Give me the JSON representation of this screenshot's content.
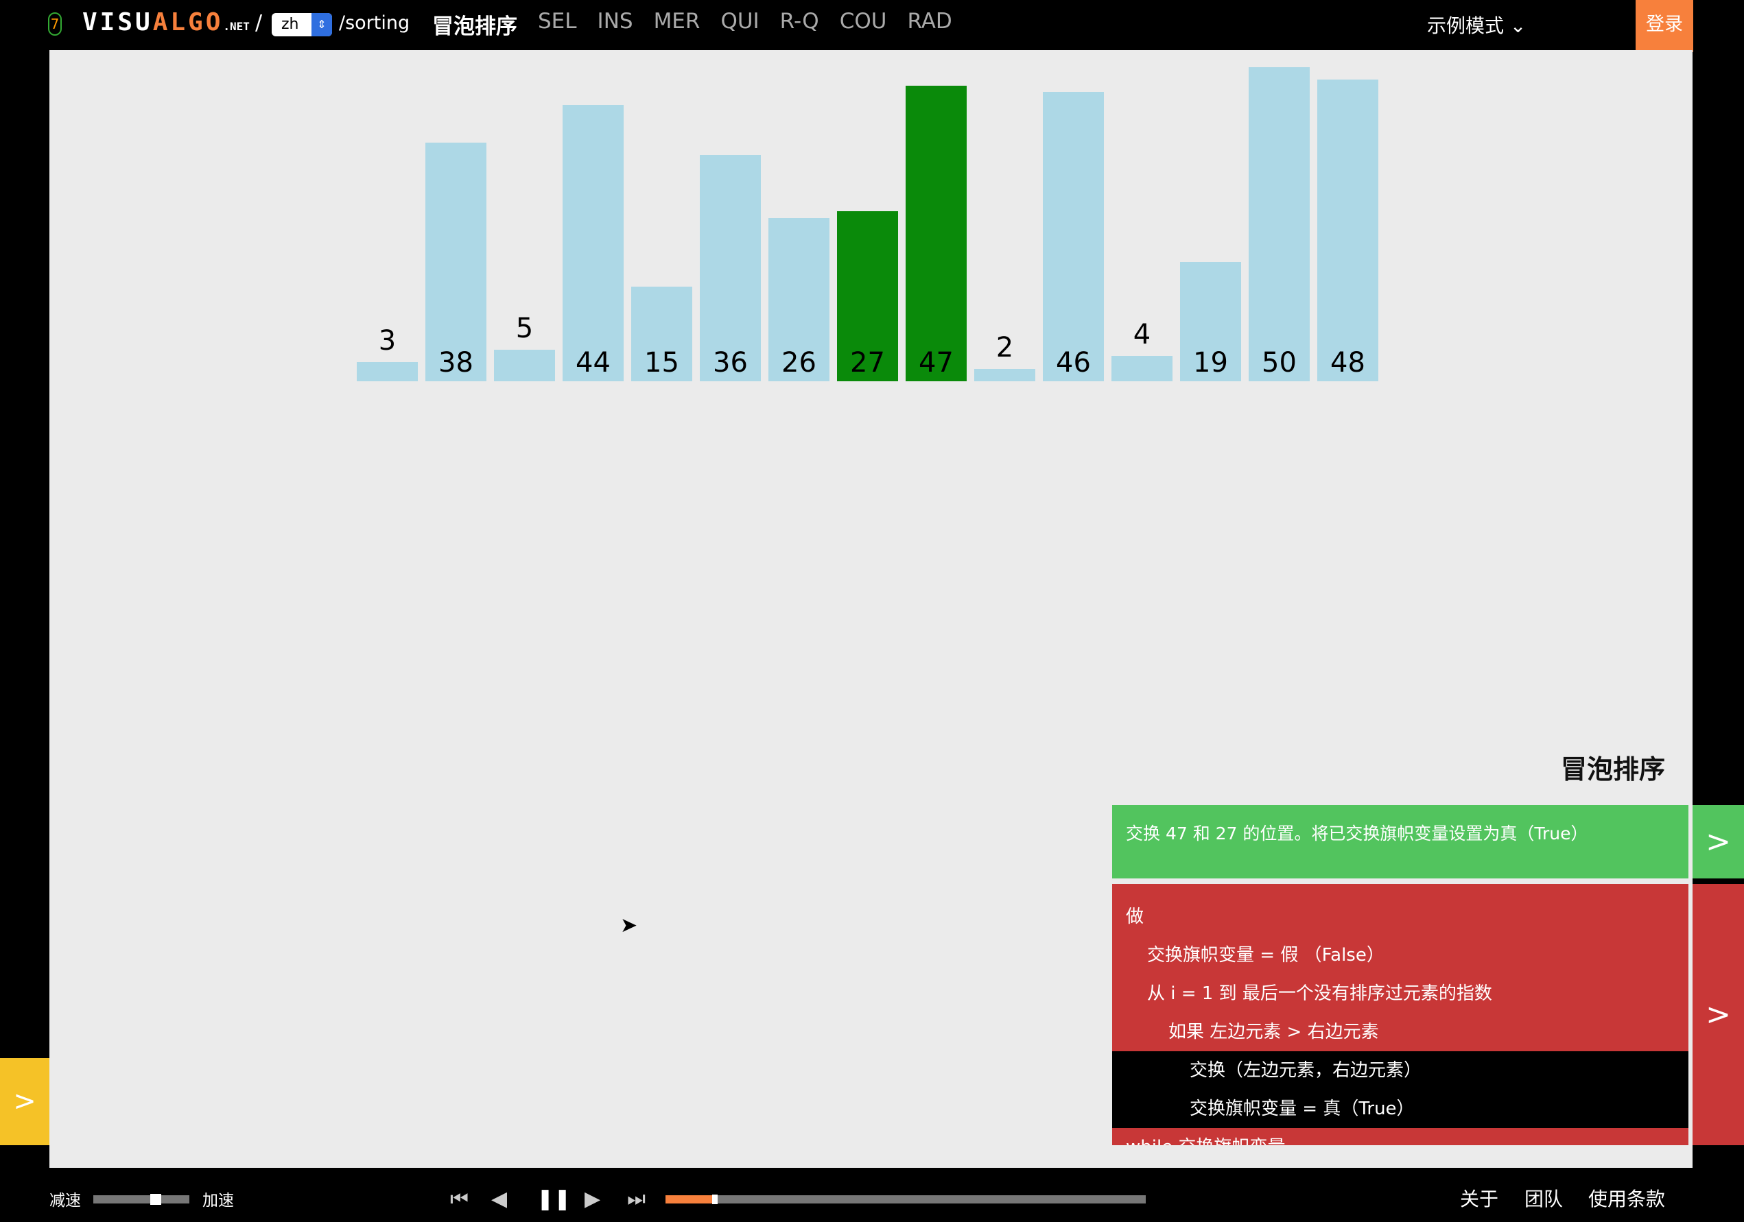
{
  "header": {
    "logo_badge": "7",
    "logo_a": "VISU",
    "logo_b": "ALGO",
    "logo_tld": ".NET",
    "slash": "/",
    "lang": "zh",
    "path": "/sorting",
    "nav": [
      {
        "label": "冒泡排序",
        "current": true
      },
      {
        "label": "SEL"
      },
      {
        "label": "INS"
      },
      {
        "label": "MER"
      },
      {
        "label": "QUI"
      },
      {
        "label": "R-Q"
      },
      {
        "label": "COU"
      },
      {
        "label": "RAD"
      }
    ],
    "mode": "示例模式 ⌄",
    "login": "登录"
  },
  "chart_data": {
    "type": "bar",
    "values": [
      3,
      38,
      5,
      44,
      15,
      36,
      26,
      27,
      47,
      2,
      46,
      4,
      19,
      50,
      48
    ],
    "highlighted": [
      7,
      8
    ],
    "bar_color": "#add8e6",
    "highlight_color": "#0a8a0a"
  },
  "algo_title": "冒泡排序",
  "status": "交换 47 和 27 的位置。将已交换旗帜变量设置为真（True）",
  "code": [
    {
      "indent": 0,
      "text": "做"
    },
    {
      "indent": 1,
      "text": "交换旗帜变量 = 假 （False）"
    },
    {
      "indent": 1,
      "text": "从 i = 1 到 最后一个没有排序过元素的指数"
    },
    {
      "indent": 2,
      "text": "如果 左边元素 > 右边元素"
    },
    {
      "indent": 3,
      "text": "交换（左边元素，右边元素）",
      "hl": true
    },
    {
      "indent": 3,
      "text": "交换旗帜变量 = 真（True）",
      "hl": true
    },
    {
      "indent": 0,
      "text": "while 交换旗帜变量"
    }
  ],
  "bottom": {
    "slower": "减速",
    "faster": "加速",
    "speed": 0.62,
    "progress": 0.1,
    "links": [
      "关于",
      "团队",
      "使用条款"
    ]
  }
}
